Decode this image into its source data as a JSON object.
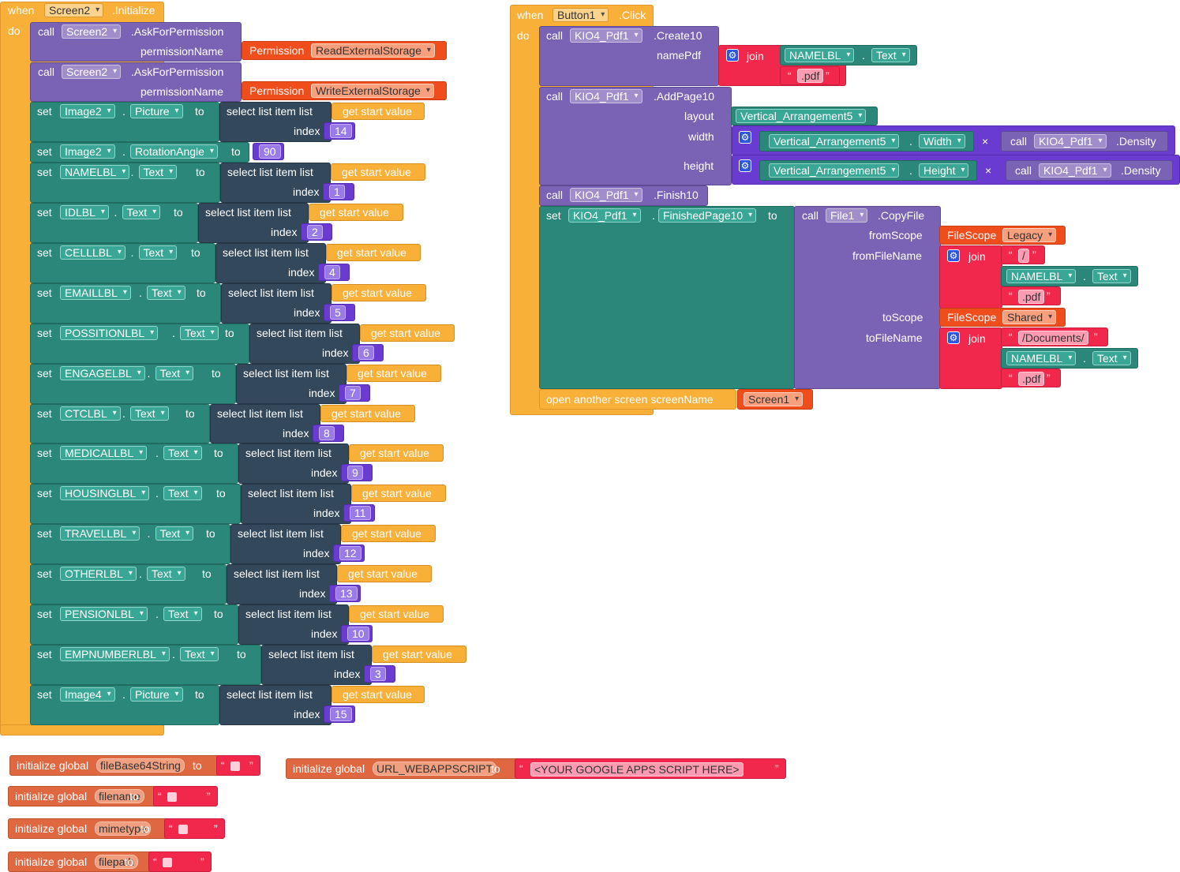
{
  "kw": {
    "when": "when",
    "do": "do",
    "call": "call",
    "set": "set",
    "to": "to",
    "select": "select list item  list",
    "index": "index",
    "get_start": "get start value",
    "join": "join",
    "permission_name": "permissionName",
    "permission": "Permission",
    "name_pdf": "namePdf",
    "layout": "layout",
    "width": "width",
    "height": "height",
    "from_scope": "fromScope",
    "from_file_name": "fromFileName",
    "to_scope": "toScope",
    "to_file_name": "toFileName",
    "file_scope": "FileScope",
    "open_screen": "open another screen  screenName",
    "init_global": "initialize global",
    "times": "×",
    "quote_open": "“",
    "quote_close": "”",
    "dot": "."
  },
  "screen_init": {
    "component": "Screen2",
    "event": ".Initialize",
    "ask_method": ".AskForPermission",
    "permissions": [
      "ReadExternalStorage",
      "WriteExternalStorage"
    ],
    "rows": [
      {
        "comp": "Image2",
        "prop": "Picture",
        "index": "14"
      },
      {
        "comp": "Image2",
        "prop": "RotationAngle",
        "value": "90"
      },
      {
        "comp": "NAMELBL",
        "prop": "Text",
        "index": "1"
      },
      {
        "comp": "IDLBL",
        "prop": "Text",
        "index": "2"
      },
      {
        "comp": "CELLLBL",
        "prop": "Text",
        "index": "4"
      },
      {
        "comp": "EMAILLBL",
        "prop": "Text",
        "index": "5"
      },
      {
        "comp": "POSSITIONLBL",
        "prop": "Text",
        "index": "6"
      },
      {
        "comp": "ENGAGELBL",
        "prop": "Text",
        "index": "7"
      },
      {
        "comp": "CTCLBL",
        "prop": "Text",
        "index": "8"
      },
      {
        "comp": "MEDICALLBL",
        "prop": "Text",
        "index": "9"
      },
      {
        "comp": "HOUSINGLBL",
        "prop": "Text",
        "index": "11"
      },
      {
        "comp": "TRAVELLBL",
        "prop": "Text",
        "index": "12"
      },
      {
        "comp": "OTHERLBL",
        "prop": "Text",
        "index": "13"
      },
      {
        "comp": "PENSIONLBL",
        "prop": "Text",
        "index": "10"
      },
      {
        "comp": "EMPNUMBERLBL",
        "prop": "Text",
        "index": "3"
      },
      {
        "comp": "Image4",
        "prop": "Picture",
        "index": "15"
      }
    ]
  },
  "button_click": {
    "component": "Button1",
    "event": ".Click",
    "pdf": "KIO4_Pdf1",
    "create": ".Create10",
    "add_page": ".AddPage10",
    "finish": ".Finish10",
    "density": ".Density",
    "finished_prop": "FinishedPage10",
    "file_comp": "File1",
    "copy_file": ".CopyFile",
    "name_lbl": "NAMELBL",
    "text_prop": "Text",
    "pdf_ext": ".pdf",
    "arrangement": "Vertical_Arrangement5",
    "width_prop": "Width",
    "height_prop": "Height",
    "scope_legacy": "Legacy",
    "scope_shared": "Shared",
    "slash": "/",
    "documents": "/Documents/",
    "screen1": "Screen1"
  },
  "globals": [
    {
      "name": "fileBase64String"
    },
    {
      "name": "URL_WEBAPPSCRIPT",
      "value": "<YOUR GOOGLE APPS SCRIPT HERE>"
    },
    {
      "name": "filename"
    },
    {
      "name": "mimetype"
    },
    {
      "name": "filepath"
    }
  ]
}
